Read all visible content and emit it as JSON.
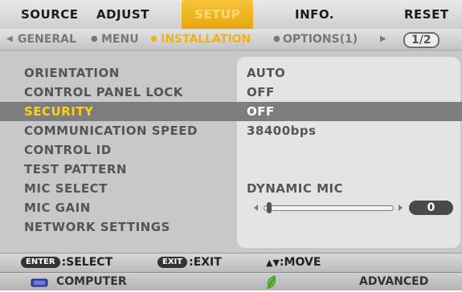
{
  "main_tabs": [
    {
      "label": "SOURCE"
    },
    {
      "label": "ADJUST"
    },
    {
      "label": "SETUP"
    },
    {
      "label": "INFO."
    },
    {
      "label": "RESET"
    }
  ],
  "sub_tabs": [
    {
      "label": "GENERAL"
    },
    {
      "label": "MENU"
    },
    {
      "label": "INSTALLATION"
    },
    {
      "label": "OPTIONS(1)"
    }
  ],
  "sub_tabs_page": "1/2",
  "settings": [
    {
      "label": "ORIENTATION",
      "value": "AUTO"
    },
    {
      "label": "CONTROL PANEL LOCK",
      "value": "OFF"
    },
    {
      "label": "SECURITY",
      "value": "OFF"
    },
    {
      "label": "COMMUNICATION SPEED",
      "value": "38400bps"
    },
    {
      "label": "CONTROL ID",
      "value": ""
    },
    {
      "label": "TEST PATTERN",
      "value": ""
    },
    {
      "label": "MIC SELECT",
      "value": "DYNAMIC MIC"
    },
    {
      "label": "MIC GAIN",
      "value": ""
    },
    {
      "label": "NETWORK SETTINGS",
      "value": ""
    }
  ],
  "selected_setting": "SECURITY",
  "mic_gain": {
    "value": "0",
    "level_fraction": 0.0
  },
  "help_bar": {
    "enter_key": "ENTER",
    "enter_action": ":SELECT",
    "exit_key": "EXIT",
    "exit_action": ":EXIT",
    "move_action": ":MOVE"
  },
  "status_bar": {
    "source_icon": "computer-icon",
    "source_label": "COMPUTER",
    "eco_icon": "leaf-icon",
    "mode_label": "ADVANCED"
  },
  "colors": {
    "active_tab": "#f0b21c",
    "selected_label": "#ffd400",
    "selected_row": "#7d7d7d"
  }
}
